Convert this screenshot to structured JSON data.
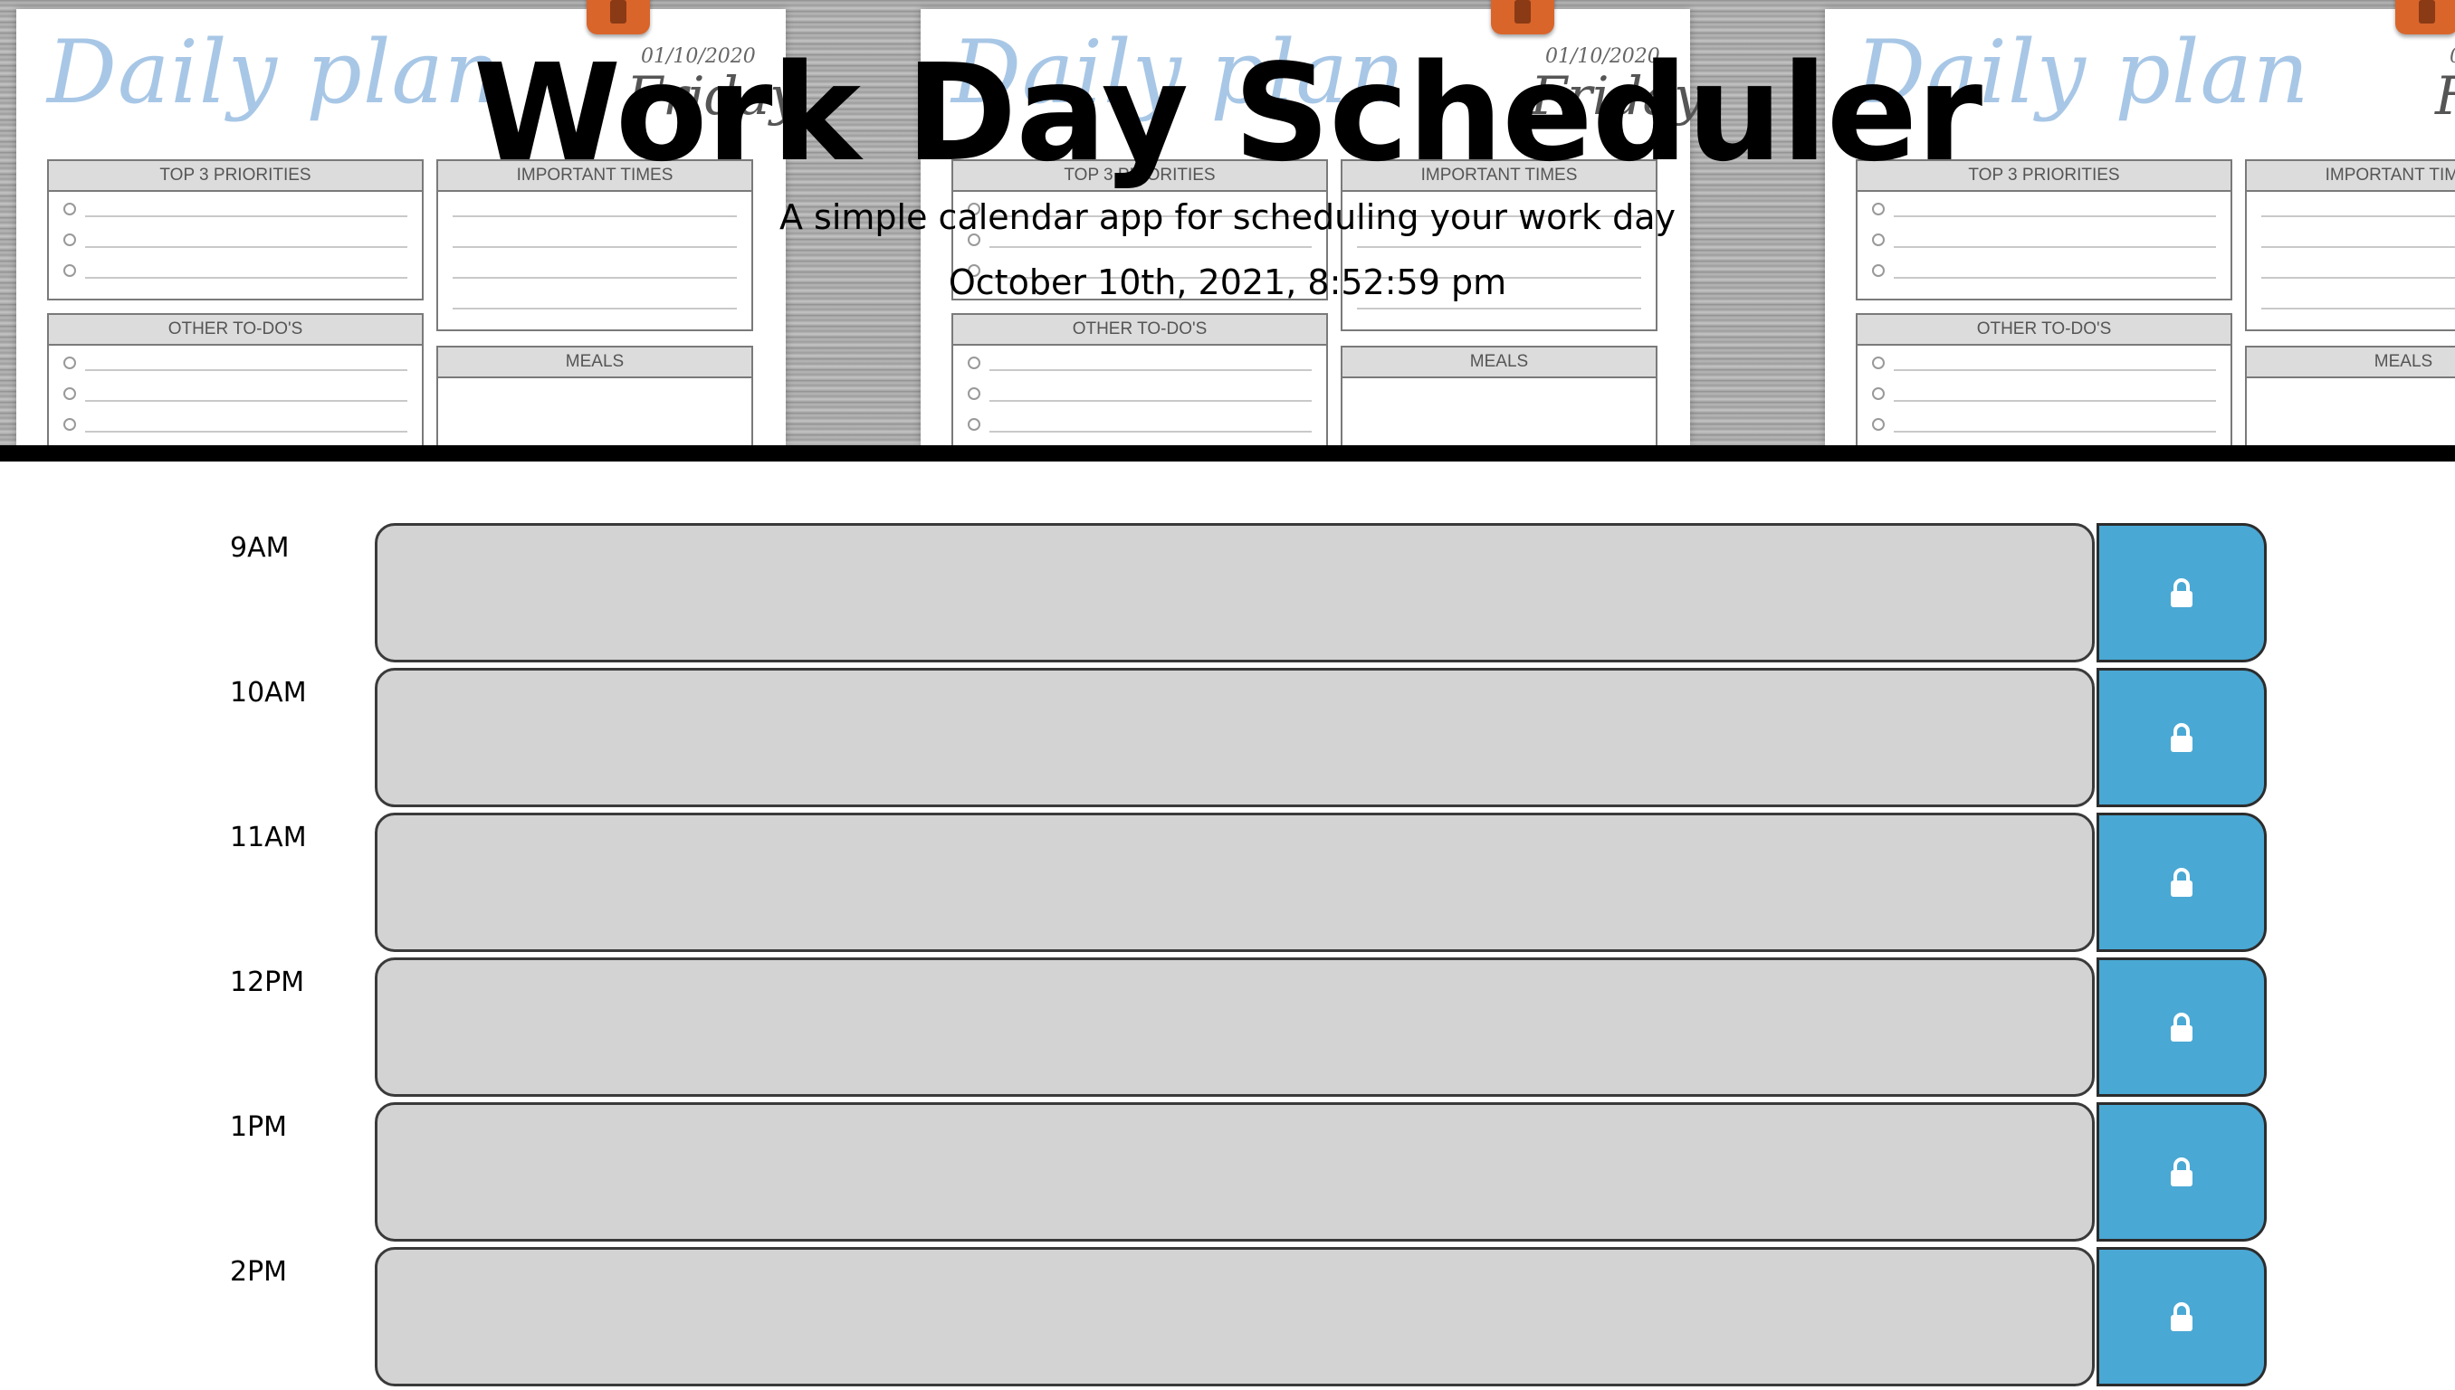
{
  "header": {
    "title": "Work Day Scheduler",
    "lead": "A simple calendar app for scheduling your work day",
    "current_day": "October 10th, 2021, 8:52:59 pm"
  },
  "background_planner": {
    "title": "Daily plan",
    "date": "01/10/2020",
    "day": "Friday",
    "sections": {
      "priorities": "TOP 3 PRIORITIES",
      "times": "IMPORTANT TIMES",
      "todos": "OTHER TO-DO'S",
      "meals": "MEALS"
    }
  },
  "colors": {
    "past_block": "#d3d3d3",
    "save_button": "#4aa8d4",
    "divider": "#000000"
  },
  "time_blocks": [
    {
      "hour": "9AM",
      "description": "",
      "save_icon": "lock-icon"
    },
    {
      "hour": "10AM",
      "description": "",
      "save_icon": "lock-icon"
    },
    {
      "hour": "11AM",
      "description": "",
      "save_icon": "lock-icon"
    },
    {
      "hour": "12PM",
      "description": "",
      "save_icon": "lock-icon"
    },
    {
      "hour": "1PM",
      "description": "",
      "save_icon": "lock-icon"
    },
    {
      "hour": "2PM",
      "description": "",
      "save_icon": "lock-icon"
    }
  ]
}
